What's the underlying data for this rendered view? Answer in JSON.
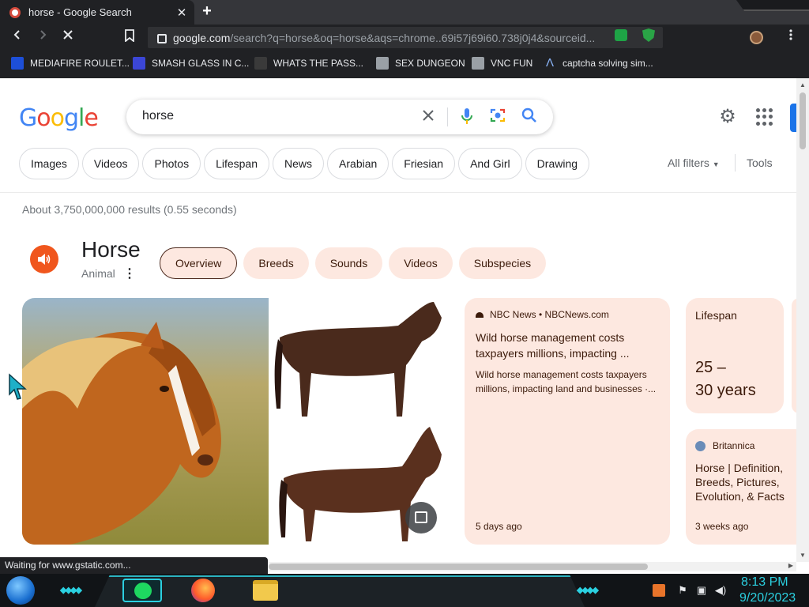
{
  "browser": {
    "tab_title": "horse - Google Search",
    "tab_close_glyph": "✕",
    "new_tab_glyph": "+",
    "url_host": "google.com",
    "url_path": "/search?q=horse&oq=horse&aqs=chrome..69i57j69i60.738j0j4&sourceid...",
    "bookmarks": [
      {
        "label": "MEDIAFIRE ROULET...",
        "icon": "mediafire-icon",
        "color": "#1d4fd8"
      },
      {
        "label": "SMASH GLASS IN C...",
        "icon": "hammer-icon",
        "color": "#3b46d6"
      },
      {
        "label": "WHATS THE PASS...",
        "icon": "lock-icon",
        "color": "#1a1a1a"
      },
      {
        "label": "SEX DUNGEON",
        "icon": "cube-icon",
        "color": "#9aa0a6"
      },
      {
        "label": "VNC FUN",
        "icon": "cube-icon",
        "color": "#9aa0a6"
      },
      {
        "label": "captcha solving sim...",
        "icon": "triangle-icon",
        "color": "#8ab4f8"
      }
    ],
    "status_text": "Waiting for www.gstatic.com..."
  },
  "google": {
    "logo_letters": [
      "G",
      "o",
      "o",
      "g",
      "l",
      "e"
    ],
    "query": "horse",
    "chips": [
      "Images",
      "Videos",
      "Photos",
      "Lifespan",
      "News",
      "Arabian",
      "Friesian",
      "And Girl",
      "Drawing"
    ],
    "all_filters": "All filters",
    "tools": "Tools",
    "result_stats": "About 3,750,000,000 results (0.55 seconds)"
  },
  "knowledge_panel": {
    "title": "Horse",
    "subtitle": "Animal",
    "more_glyph": "⋮",
    "tabs": [
      "Overview",
      "Breeds",
      "Sounds",
      "Videos",
      "Subspecies"
    ],
    "active_tab": "Overview",
    "news_card": {
      "source": "NBC News • NBCNews.com",
      "title": "Wild horse management costs taxpayers millions, impacting ...",
      "snippet": "Wild horse management costs taxpayers millions, impacting land and businesses ·...",
      "date": "5 days ago"
    },
    "lifespan_card": {
      "label": "Lifespan",
      "value_line1": "25 –",
      "value_line2": "30 years"
    },
    "britannica_card": {
      "source": "Britannica",
      "title": "Horse | Definition, Breeds, Pictures, Evolution, & Facts",
      "date": "3 weeks ago"
    }
  },
  "taskbar": {
    "time": "8:13 PM",
    "date": "9/20/2023"
  },
  "colors": {
    "accent_blue": "#1a73e8",
    "kp_card_bg": "#fde8e0",
    "kp_text": "#3c1a0a",
    "audio_orange": "#f0561d",
    "taskbar_cyan": "#2bd0e0"
  }
}
